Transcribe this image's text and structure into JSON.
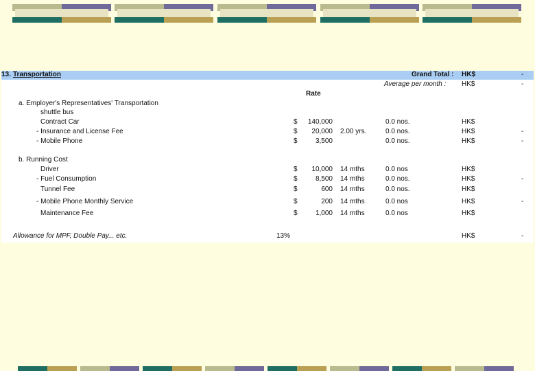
{
  "section": {
    "number": "13.",
    "title": "Transportation",
    "grand_total_label": "Grand Total :",
    "grand_total_currency": "HK$",
    "grand_total_value": "-",
    "avg_month_label": "Average per month :",
    "avg_month_currency": "HK$",
    "avg_month_value": "-",
    "rate_header": "Rate"
  },
  "groups": {
    "a_title": "a. Employer's Representatives' Transportation",
    "b_title": "b. Running Cost"
  },
  "rows": [
    {
      "label": "shuttle bus",
      "cur": "",
      "amount": "",
      "duration": "",
      "qty": "",
      "hk": "",
      "val": ""
    },
    {
      "label": "Contract Car",
      "cur": "$",
      "amount": "140,000",
      "duration": "",
      "qty": "0.0 nos.",
      "hk": "HK$",
      "val": ""
    },
    {
      "label": "- Insurance and License Fee",
      "cur": "$",
      "amount": "20,000",
      "duration": "2.00 yrs.",
      "qty": "0.0 nos.",
      "hk": "HK$",
      "val": "-"
    },
    {
      "label": "- Mobile Phone",
      "cur": "$",
      "amount": "3,500",
      "duration": "",
      "qty": "0.0 nos.",
      "hk": "HK$",
      "val": "-"
    },
    {
      "label": "Driver",
      "cur": "$",
      "amount": "10,000",
      "duration": "14 mths",
      "qty": "0.0 nos",
      "hk": "HK$",
      "val": ""
    },
    {
      "label": "- Fuel Consumption",
      "cur": "$",
      "amount": "8,500",
      "duration": "14 mths",
      "qty": "0.0 nos.",
      "hk": "HK$",
      "val": "-"
    },
    {
      "label": "Tunnel Fee",
      "cur": "$",
      "amount": "600",
      "duration": "14 mths",
      "qty": "0.0 nos.",
      "hk": "HK$",
      "val": ""
    },
    {
      "label": "- Mobile Phone Monthly Service",
      "cur": "$",
      "amount": "200",
      "duration": "14 mths",
      "qty": "0.0 nos",
      "hk": "HK$",
      "val": "-"
    },
    {
      "label": "Maintenance Fee",
      "cur": "$",
      "amount": "1,000",
      "duration": "14 mths",
      "qty": "0.0 nos",
      "hk": "HK$",
      "val": ""
    }
  ],
  "allowance": {
    "label": "Allowance for MPF, Double Pay... etc.",
    "percent": "13%",
    "currency": "HK$",
    "value": "-"
  },
  "colors": {
    "background": "#fffde0",
    "header_bar": "#a9cdf3",
    "deco_sage": "#b9bb8e",
    "deco_purple": "#6f6a9a",
    "deco_cream": "#e8e4c3",
    "deco_teal": "#1f6e63",
    "deco_gold": "#b9a052"
  }
}
